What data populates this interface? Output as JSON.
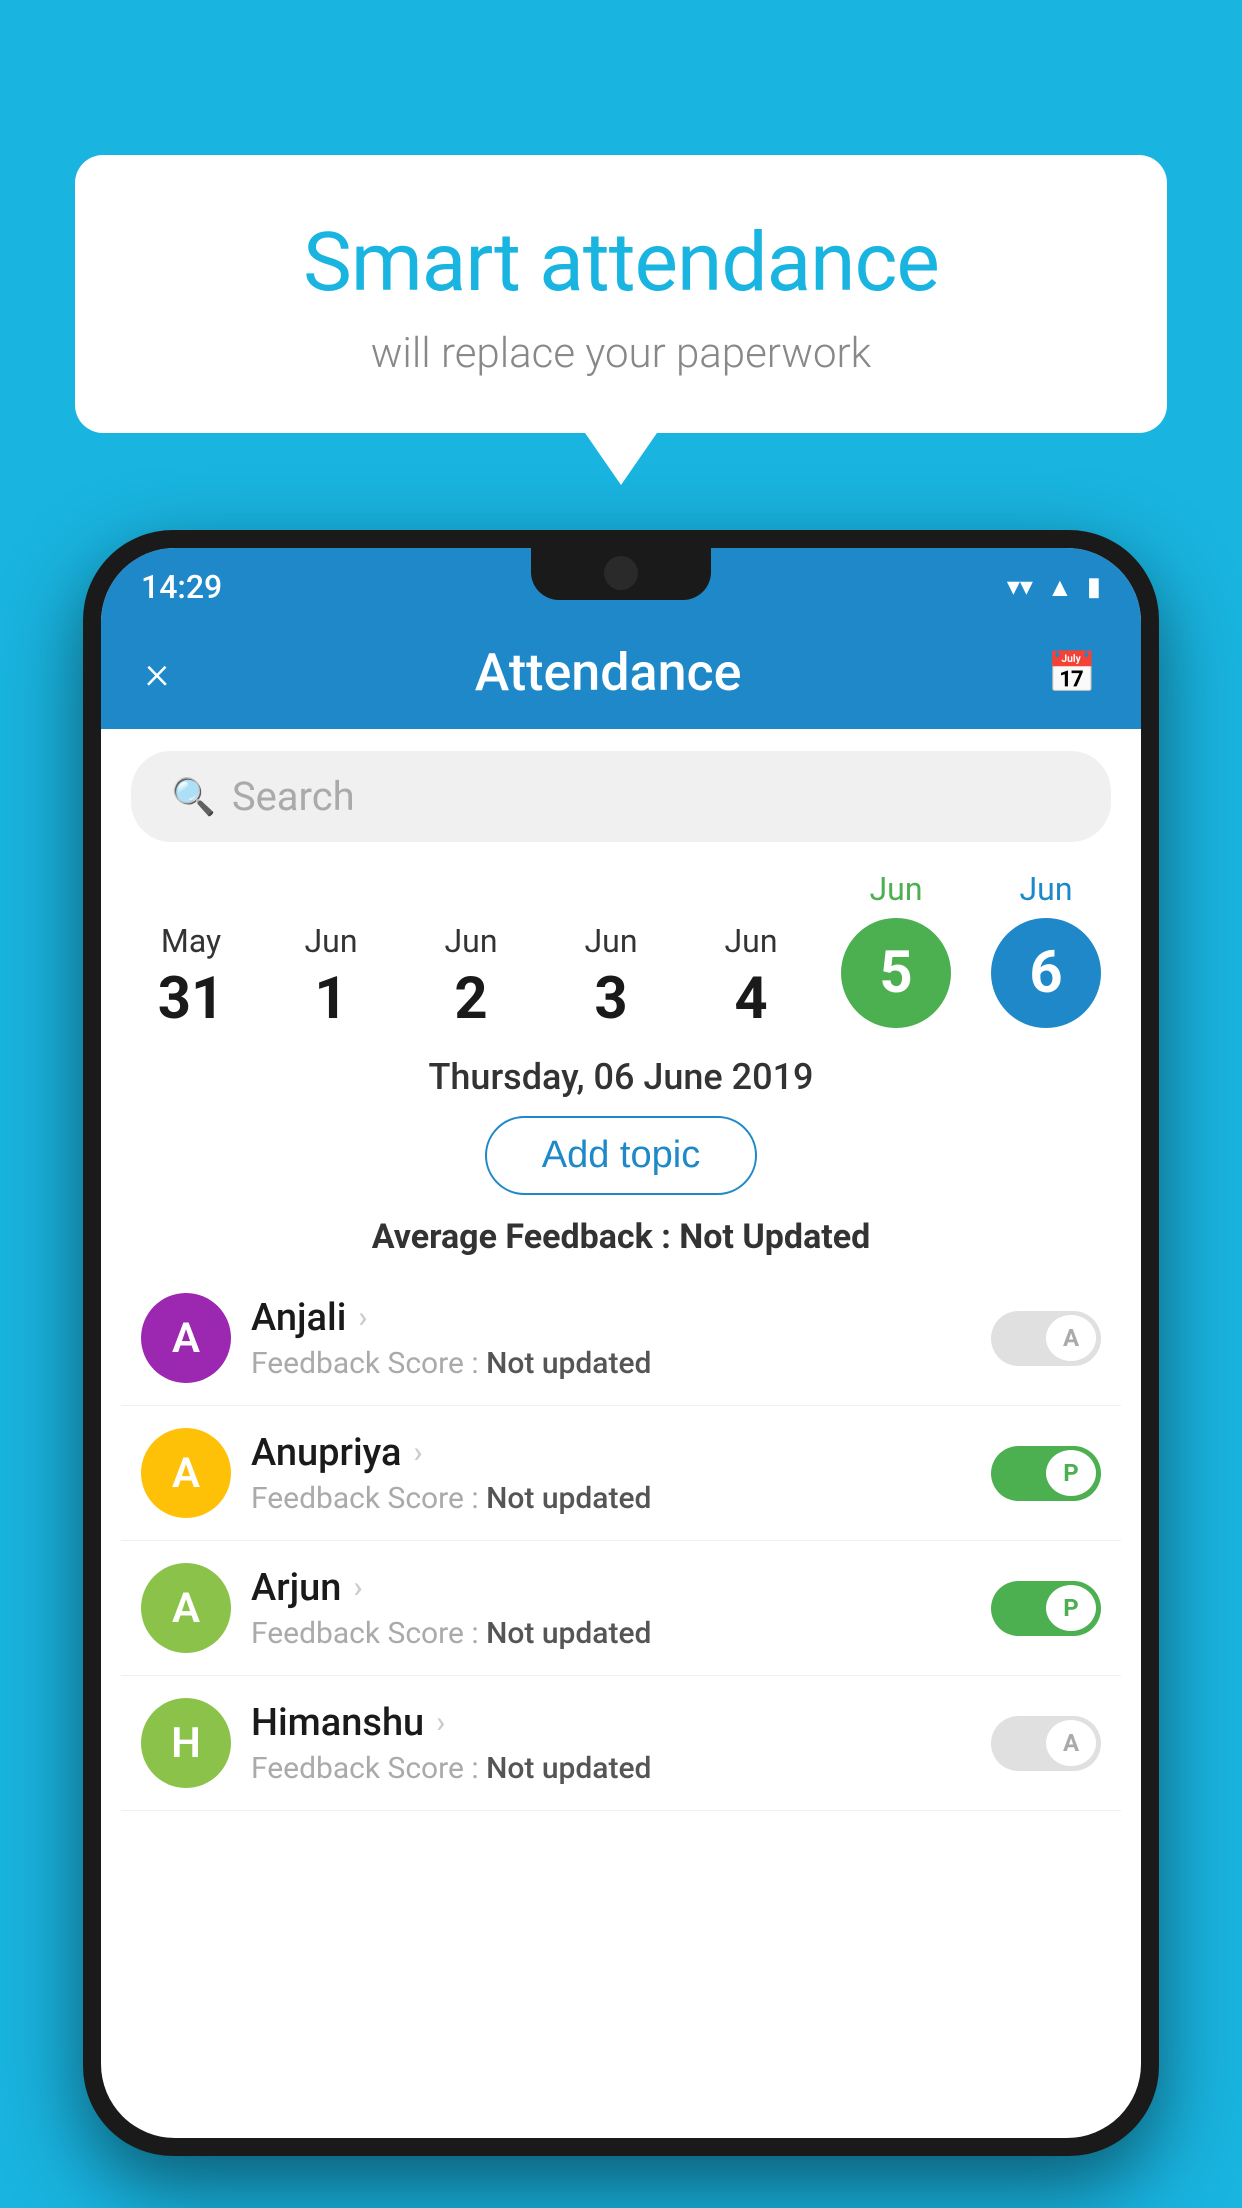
{
  "background_color": "#19b4e0",
  "speech_bubble": {
    "title": "Smart attendance",
    "subtitle": "will replace your paperwork"
  },
  "status_bar": {
    "time": "14:29",
    "icons": [
      "wifi",
      "signal",
      "battery"
    ]
  },
  "header": {
    "title": "Attendance",
    "close_label": "×",
    "calendar_icon": "📅"
  },
  "search": {
    "placeholder": "Search"
  },
  "calendar": {
    "dates": [
      {
        "month": "May",
        "day": "31",
        "type": "normal"
      },
      {
        "month": "Jun",
        "day": "1",
        "type": "normal"
      },
      {
        "month": "Jun",
        "day": "2",
        "type": "normal"
      },
      {
        "month": "Jun",
        "day": "3",
        "type": "normal"
      },
      {
        "month": "Jun",
        "day": "4",
        "type": "normal"
      },
      {
        "month": "Jun",
        "day": "5",
        "type": "green"
      },
      {
        "month": "Jun",
        "day": "6",
        "type": "blue"
      }
    ],
    "selected_label": "Thursday, 06 June 2019"
  },
  "add_topic_label": "Add topic",
  "avg_feedback_label": "Average Feedback :",
  "avg_feedback_value": "Not Updated",
  "students": [
    {
      "name": "Anjali",
      "avatar_letter": "A",
      "avatar_color": "#9c27b0",
      "feedback_label": "Feedback Score :",
      "feedback_value": "Not updated",
      "status": "absent"
    },
    {
      "name": "Anupriya",
      "avatar_letter": "A",
      "avatar_color": "#ffc107",
      "feedback_label": "Feedback Score :",
      "feedback_value": "Not updated",
      "status": "present"
    },
    {
      "name": "Arjun",
      "avatar_letter": "A",
      "avatar_color": "#8bc34a",
      "feedback_label": "Feedback Score :",
      "feedback_value": "Not updated",
      "status": "present"
    },
    {
      "name": "Himanshu",
      "avatar_letter": "H",
      "avatar_color": "#8bc34a",
      "feedback_label": "Feedback Score :",
      "feedback_value": "Not updated",
      "status": "absent"
    }
  ]
}
